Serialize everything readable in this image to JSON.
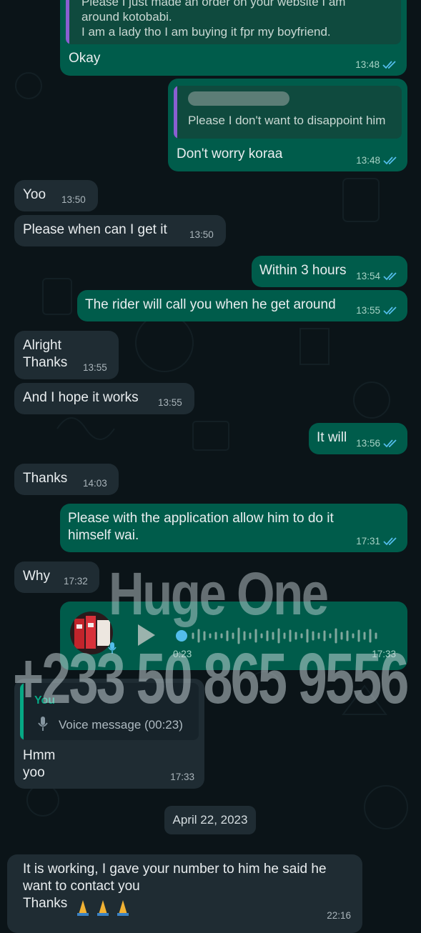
{
  "messages": {
    "m1_quote": "Please I just made an order on your website I am\naround kotobabi.\nI am a lady tho I am buying it fpr my boyfriend.",
    "m1_text": "Okay",
    "m1_time": "13:48",
    "m2_quote": "Please I don't want to disappoint him",
    "m2_text": "Don't worry koraa",
    "m2_time": "13:48",
    "m3_text": "Yoo",
    "m3_time": "13:50",
    "m4_text": "Please when can I get it",
    "m4_time": "13:50",
    "m5_text": "Within 3 hours",
    "m5_time": "13:54",
    "m6_text": "The rider will call you when he get around",
    "m6_time": "13:55",
    "m7_text": "Alright\nThanks",
    "m7_time": "13:55",
    "m8_text": "And I hope it works",
    "m8_time": "13:55",
    "m9_text": "It will",
    "m9_time": "13:56",
    "m10_text": "Thanks",
    "m10_time": "14:03",
    "m11_text": "Please with the application allow him to do it\nhimself wai.",
    "m11_time": "17:31",
    "m12_text": "Why",
    "m12_time": "17:32",
    "voice_duration": "0:23",
    "voice_time": "17:33",
    "m13_quote_author": "You",
    "m13_quote_text": "Voice message (00:23)",
    "m13_text": "Hmm\n yoo",
    "m13_time": "17:33",
    "m14_text": "It is working, I gave your number to him he said he\nwant to contact you\nThanks",
    "m14_time": "22:16"
  },
  "date_chip": "April 22, 2023",
  "watermark": {
    "line1": "Huge One",
    "line2": "+233 50 865 9556"
  },
  "colors": {
    "background": "#0b1418",
    "incoming_bubble": "#1f2c33",
    "outgoing_bubble": "#005c4b",
    "read_ticks": "#53bdeb",
    "quote_bar_outgoing": "#8a5fd1",
    "quote_bar_incoming": "#06a884"
  },
  "icons": {
    "ticks": "double-check-icon",
    "play": "play-icon",
    "mic": "microphone-icon",
    "emoji": "folded-hands-emoji"
  }
}
